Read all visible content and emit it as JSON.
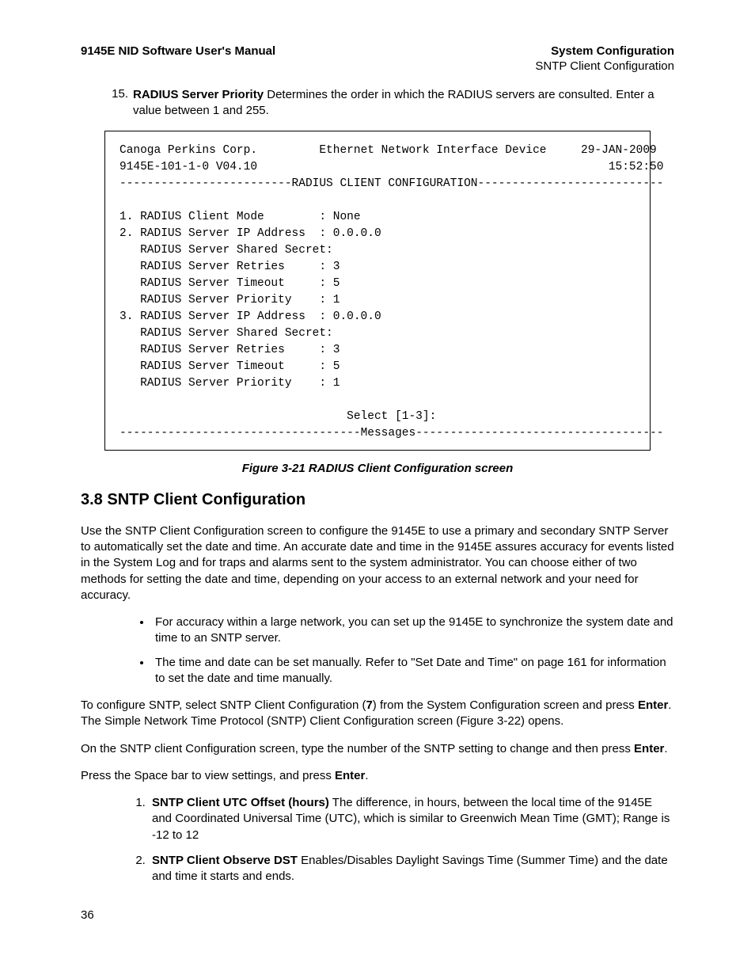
{
  "header": {
    "left": "9145E NID Software User's Manual",
    "right": "System Configuration",
    "sub": "SNTP Client Configuration"
  },
  "item15": {
    "num": "15.",
    "bold": "RADIUS Server Priority",
    "rest": " Determines the order in which the RADIUS servers are consulted. Enter a value between 1 and 255."
  },
  "terminal": {
    "line1_left": "Canoga Perkins Corp.",
    "line1_mid": "Ethernet Network Interface Device",
    "line1_right": "29-JAN-2009",
    "line2_left": "9145E-101-1-0 V04.10",
    "line2_right": "15:52:50",
    "divider_title": "RADIUS CLIENT CONFIGURATION",
    "r1": "1. RADIUS Client Mode        : None",
    "r2": "2. RADIUS Server IP Address  : 0.0.0.0",
    "r3": "   RADIUS Server Shared Secret:",
    "r4": "   RADIUS Server Retries     : 3",
    "r5": "   RADIUS Server Timeout     : 5",
    "r6": "   RADIUS Server Priority    : 1",
    "r7": "3. RADIUS Server IP Address  : 0.0.0.0",
    "r8": "   RADIUS Server Shared Secret:",
    "r9": "   RADIUS Server Retries     : 3",
    "r10": "   RADIUS Server Timeout     : 5",
    "r11": "   RADIUS Server Priority    : 1",
    "select": "Select [1-3]:",
    "msg_title": "Messages"
  },
  "figure_caption": "Figure 3-21  RADIUS Client Configuration screen",
  "section_heading": "3.8  SNTP Client Configuration",
  "para1": "Use the SNTP Client Configuration screen to configure the 9145E to use a primary and secondary SNTP Server to automatically set the date and time. An accurate date and time in the 9145E assures accuracy for events listed in the System Log and for traps and alarms sent to the system administrator. You can choose either of two methods for setting the date and time, depending on your access to an external network and your need for accuracy.",
  "bullet1": "For accuracy within a large network, you can set up the 9145E to synchronize the system date and time to an SNTP server.",
  "bullet2": "The time and date can be set manually. Refer to \"Set Date and Time\" on page 161 for information to set the date and time manually.",
  "para2_a": "To configure SNTP, select SNTP Client Configuration (",
  "para2_b": "7",
  "para2_c": ") from the System Configuration screen and press ",
  "para2_d": "Enter",
  "para2_e": ". The Simple Network Time Protocol (SNTP) Client Configuration screen (Figure 3-22) opens.",
  "para3_a": "On the SNTP client Configuration screen, type the number of the SNTP setting to change and then press ",
  "para3_b": "Enter",
  "para3_c": ".",
  "para4_a": "Press the Space bar to view settings, and press ",
  "para4_b": "Enter",
  "para4_c": ".",
  "num1": {
    "bold": "SNTP Client UTC Offset (hours)",
    "rest": "  The difference, in hours, between the local time of the 9145E and Coordinated Universal Time (UTC), which is similar to Greenwich Mean Time (GMT); Range is -12 to 12"
  },
  "num2": {
    "bold": "SNTP Client Observe DST",
    "rest": " Enables/Disables Daylight Savings Time (Summer Time) and the date and time it starts and ends."
  },
  "page_number": "36"
}
